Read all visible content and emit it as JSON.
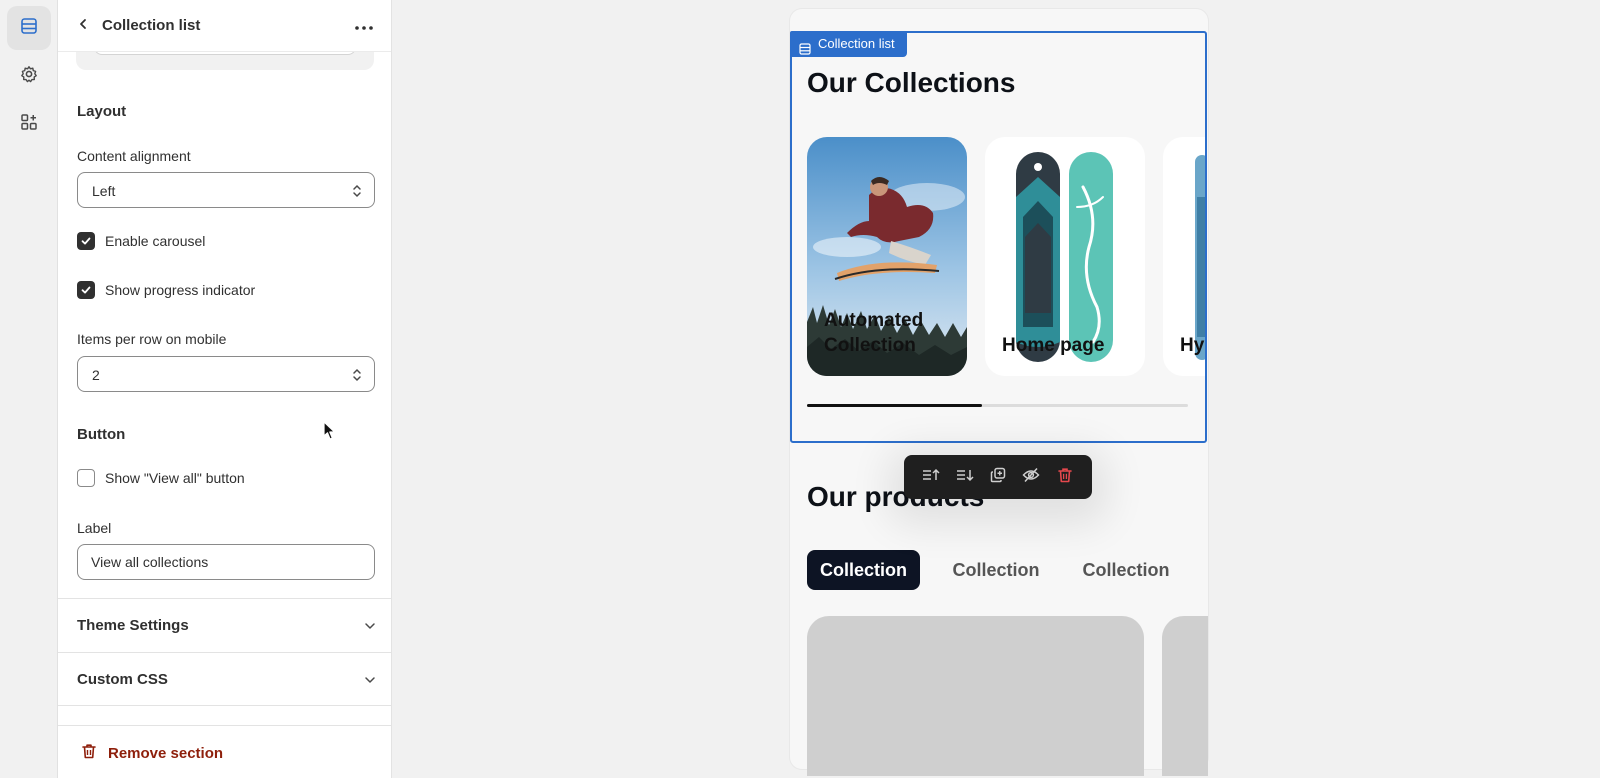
{
  "rail": {
    "items": [
      {
        "icon": "sections-icon",
        "active": true
      },
      {
        "icon": "settings-gear-icon",
        "active": false
      },
      {
        "icon": "apps-add-icon",
        "active": false
      }
    ]
  },
  "panel": {
    "title": "Collection list",
    "layout": {
      "heading": "Layout",
      "content_alignment_label": "Content alignment",
      "content_alignment_value": "Left",
      "enable_carousel_label": "Enable carousel",
      "enable_carousel_checked": true,
      "show_progress_label": "Show progress indicator",
      "show_progress_checked": true,
      "items_per_row_label": "Items per row on mobile",
      "items_per_row_value": "2"
    },
    "button": {
      "heading": "Button",
      "show_view_all_label": "Show \"View all\" button",
      "show_view_all_checked": false,
      "label_label": "Label",
      "label_value": "View all collections"
    },
    "accordions": [
      "Theme Settings",
      "Custom CSS"
    ],
    "remove_label": "Remove section"
  },
  "preview": {
    "selection_tag": "Collection list",
    "collections_heading": "Our Collections",
    "cards": [
      {
        "label_line1": "Automated",
        "label_line2": "Collection"
      },
      {
        "label_line1": "",
        "label_line2": "Home page"
      },
      {
        "label_line1": "",
        "label_line2": "Hy"
      }
    ],
    "progress_fraction": 0.46,
    "toolbar_icons": [
      "move-up-icon",
      "move-down-icon",
      "duplicate-icon",
      "hide-icon",
      "delete-icon"
    ],
    "products_heading": "Our products",
    "tabs": [
      "Collection",
      "Collection",
      "Collection"
    ],
    "active_tab_index": 0
  },
  "colors": {
    "accent": "#2c6ecb",
    "remove": "#8e1f0b",
    "delete_icon": "#e5484d",
    "active_tab": "#0d1424"
  }
}
